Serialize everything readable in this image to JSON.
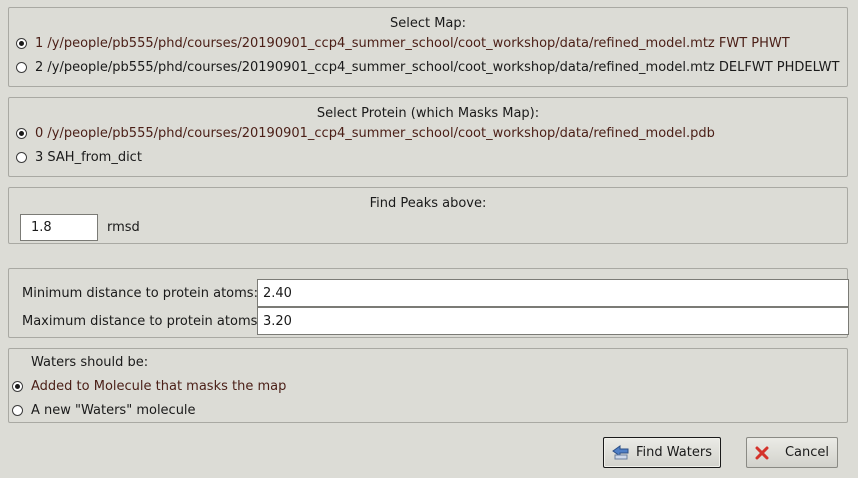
{
  "select_map": {
    "title": "Select Map:",
    "options": [
      {
        "label": "1 /y/people/pb555/phd/courses/20190901_ccp4_summer_school/coot_workshop/data/refined_model.mtz FWT PHWT",
        "selected": true
      },
      {
        "label": "2 /y/people/pb555/phd/courses/20190901_ccp4_summer_school/coot_workshop/data/refined_model.mtz DELFWT PHDELWT",
        "selected": false
      }
    ]
  },
  "select_protein": {
    "title": "Select Protein (which Masks Map):",
    "options": [
      {
        "label": "0 /y/people/pb555/phd/courses/20190901_ccp4_summer_school/coot_workshop/data/refined_model.pdb",
        "selected": true
      },
      {
        "label": "3 SAH_from_dict",
        "selected": false
      }
    ]
  },
  "peaks": {
    "title": "Find Peaks above:",
    "value": "1.8",
    "unit": "rmsd"
  },
  "distances": {
    "min_label": "Minimum distance to protein atoms:",
    "min_value": "2.40",
    "max_label": "Maximum distance to protein atoms:",
    "max_value": "3.20"
  },
  "waters": {
    "title": "Waters should be:",
    "options": [
      {
        "label": "Added to Molecule that masks the map",
        "selected": true
      },
      {
        "label": "A new \"Waters\" molecule",
        "selected": false
      }
    ]
  },
  "buttons": {
    "find_waters": "Find Waters",
    "cancel": "Cancel"
  },
  "colors": {
    "background": "#dcdcd6",
    "selected_text": "#4a1e16",
    "cancel_icon": "#d4322a",
    "find_icon": "#4f7fc6"
  },
  "icons": {
    "find_waters": "find-waters-icon",
    "cancel": "cancel-x-icon"
  }
}
